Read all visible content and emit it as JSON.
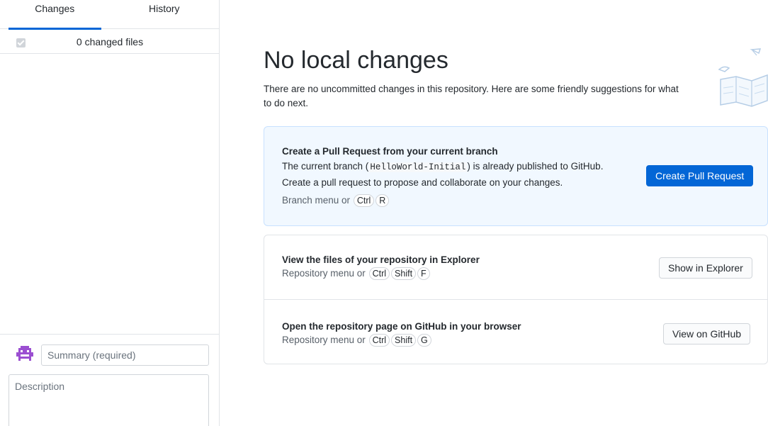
{
  "sidebar": {
    "tabs": [
      {
        "label": "Changes",
        "active": true
      },
      {
        "label": "History",
        "active": false
      }
    ],
    "changed_files_label": "0 changed files",
    "commit": {
      "summary_placeholder": "Summary (required)",
      "description_placeholder": "Description"
    }
  },
  "main": {
    "title": "No local changes",
    "subtitle": "There are no uncommitted changes in this repository. Here are some friendly suggestions for what to do next.",
    "pull_request": {
      "title": "Create a Pull Request from your current branch",
      "text_before": "The current branch (",
      "branch": "HelloWorld-Initial",
      "text_after": ") is already published to GitHub.",
      "text2": "Create a pull request to propose and collaborate on your changes.",
      "hint_prefix": "Branch menu or",
      "keys": [
        "Ctrl",
        "R"
      ],
      "button": "Create Pull Request"
    },
    "explorer": {
      "title": "View the files of your repository in Explorer",
      "hint_prefix": "Repository menu or",
      "keys": [
        "Ctrl",
        "Shift",
        "F"
      ],
      "button": "Show in Explorer"
    },
    "github": {
      "title": "Open the repository page on GitHub in your browser",
      "hint_prefix": "Repository menu or",
      "keys": [
        "Ctrl",
        "Shift",
        "G"
      ],
      "button": "View on GitHub"
    }
  },
  "colors": {
    "accent": "#0366d6",
    "card_bg": "#f1f8ff",
    "border": "#e1e4e8"
  }
}
